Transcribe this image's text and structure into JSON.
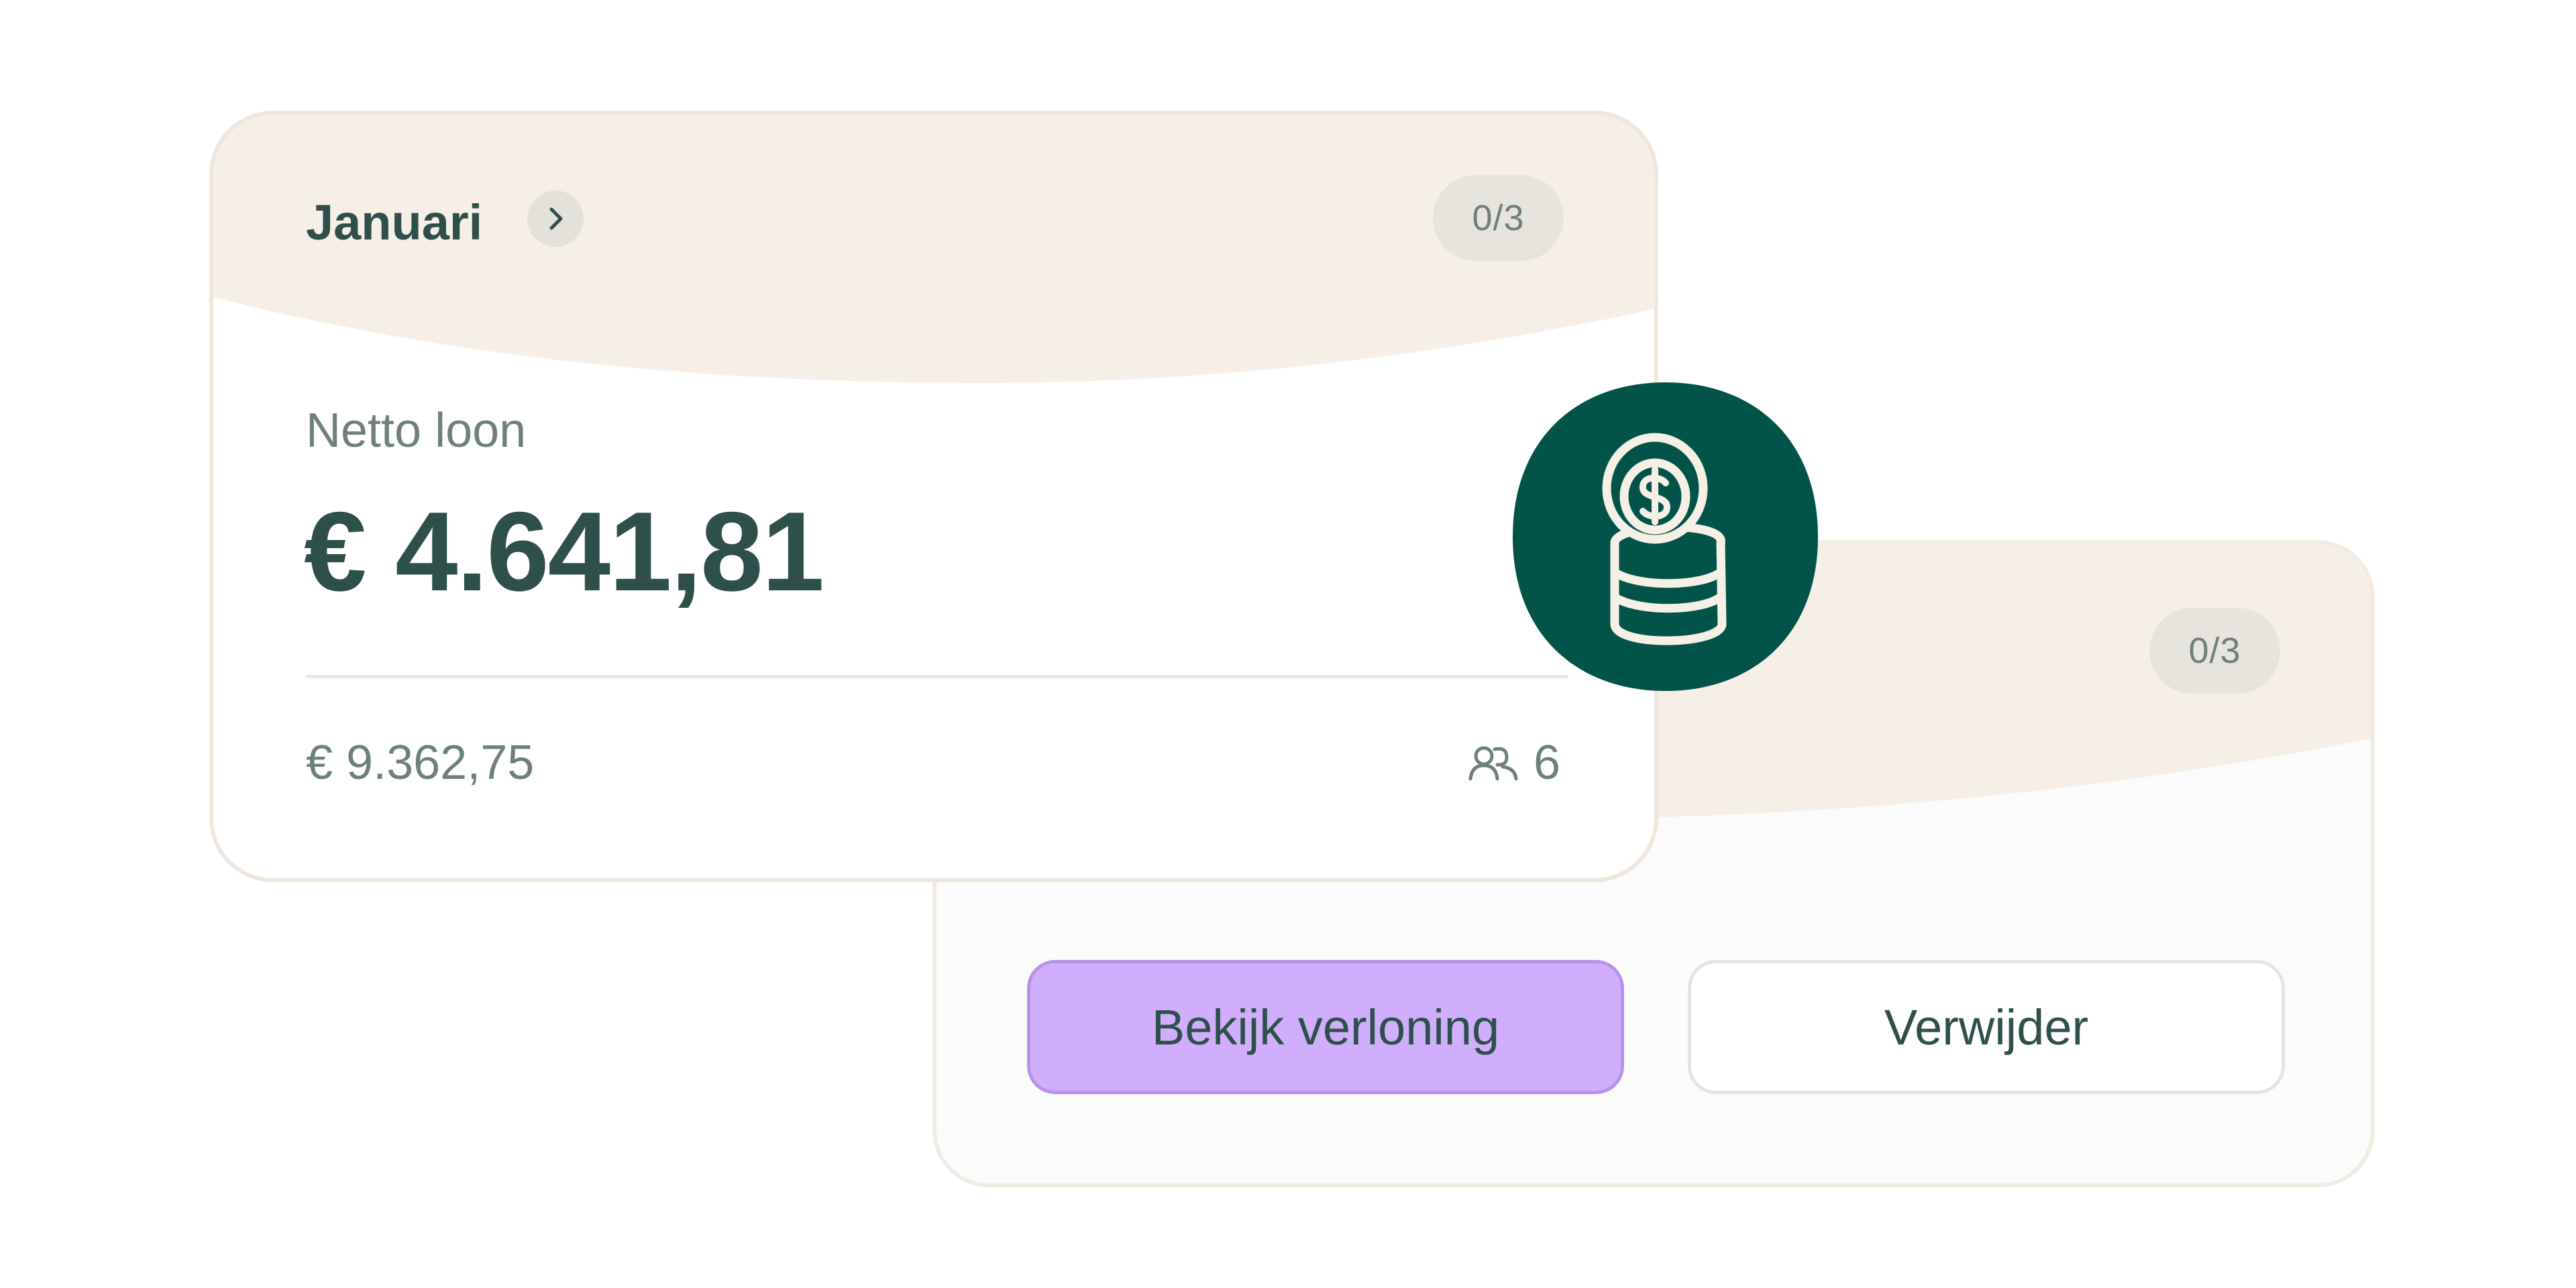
{
  "colors": {
    "dark_green": "#025448",
    "text_dark": "#2e4f4a",
    "text_muted": "#6d807b",
    "band_beige": "#f6efe8",
    "button_purple": "#d0aefb"
  },
  "front_card": {
    "month": "Januari",
    "month_icon": "chevron-right-icon",
    "progress_badge": "0/3",
    "net_label": "Netto loon",
    "net_amount": "€ 4.641,81",
    "gross_amount": "€ 9.362,75",
    "people_icon": "people-icon",
    "people_count": "6"
  },
  "back_card": {
    "progress_badge": "0/3",
    "view_button": "Bekijk verloning",
    "delete_button": "Verwijder"
  },
  "bubble": {
    "icon": "coin-stack-dollar-icon"
  }
}
